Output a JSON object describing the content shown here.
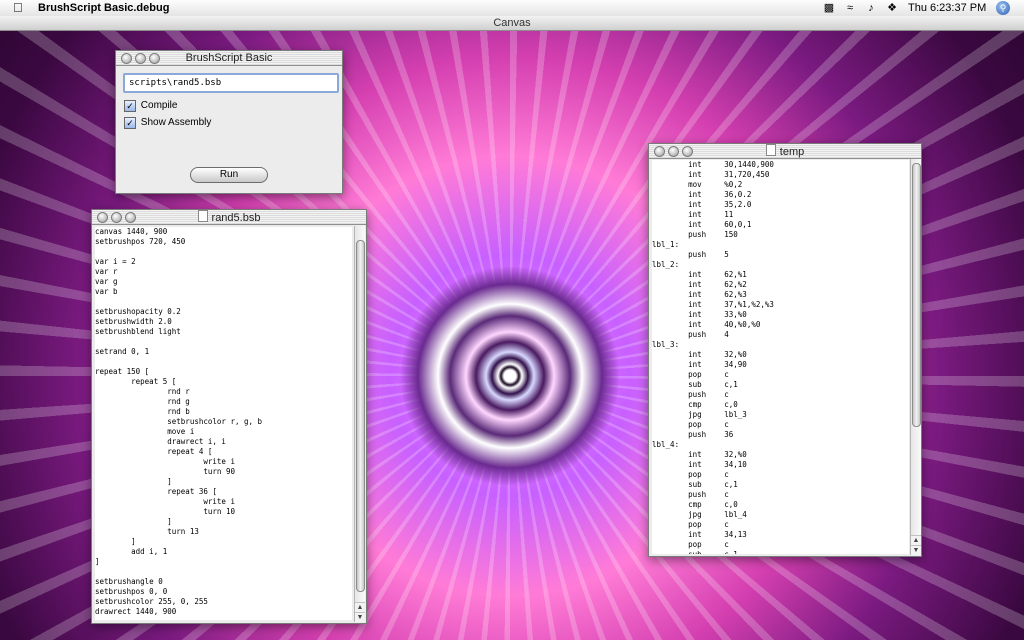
{
  "menubar": {
    "app_name": "BrushScript Basic.debug",
    "clock": "Thu 6:23:37 PM",
    "icons": [
      "apple-icon",
      "display-icon",
      "wifi-icon",
      "volume-icon",
      "bluetooth-icon",
      "spotlight-icon"
    ]
  },
  "canvas_window": {
    "title": "Canvas"
  },
  "brushscript_window": {
    "title": "BrushScript Basic",
    "script_path": "scripts\\rand5.bsb",
    "compile_label": "Compile",
    "compile_checked": true,
    "show_assembly_label": "Show Assembly",
    "show_assembly_checked": true,
    "run_label": "Run"
  },
  "source_window": {
    "title": "rand5.bsb",
    "code": "canvas 1440, 900\nsetbrushpos 720, 450\n\nvar i = 2\nvar r\nvar g\nvar b\n\nsetbrushopacity 0.2\nsetbrushwidth 2.0\nsetbrushblend light\n\nsetrand 0, 1\n\nrepeat 150 [\n        repeat 5 [\n                rnd r\n                rnd g\n                rnd b\n                setbrushcolor r, g, b\n                move i\n                drawrect i, i\n                repeat 4 [\n                        write i\n                        turn 90\n                ]\n                repeat 36 [\n                        write i\n                        turn 10\n                ]\n                turn 13\n        ]\n        add i, 1\n]\n\nsetbrushangle 0\nsetbrushpos 0, 0\nsetbrushcolor 255, 0, 255\ndrawrect 1440, 900"
  },
  "assembly_window": {
    "title": "temp",
    "code": "        int     30,1440,900\n        int     31,720,450\n        mov     %0,2\n        int     36,0.2\n        int     35,2.0\n        int     11\n        int     60,0,1\n        push    150\nlbl_1:\n        push    5\nlbl_2:\n        int     62,%1\n        int     62,%2\n        int     62,%3\n        int     37,%1,%2,%3\n        int     33,%0\n        int     40,%0,%0\n        push    4\nlbl_3:\n        int     32,%0\n        int     34,90\n        pop     c\n        sub     c,1\n        push    c\n        cmp     c,0\n        jpg     lbl_3\n        pop     c\n        push    36\nlbl_4:\n        int     32,%0\n        int     34,10\n        pop     c\n        sub     c,1\n        push    c\n        cmp     c,0\n        jpg     lbl_4\n        pop     c\n        int     34,13\n        pop     c\n        sub     c,1"
  }
}
